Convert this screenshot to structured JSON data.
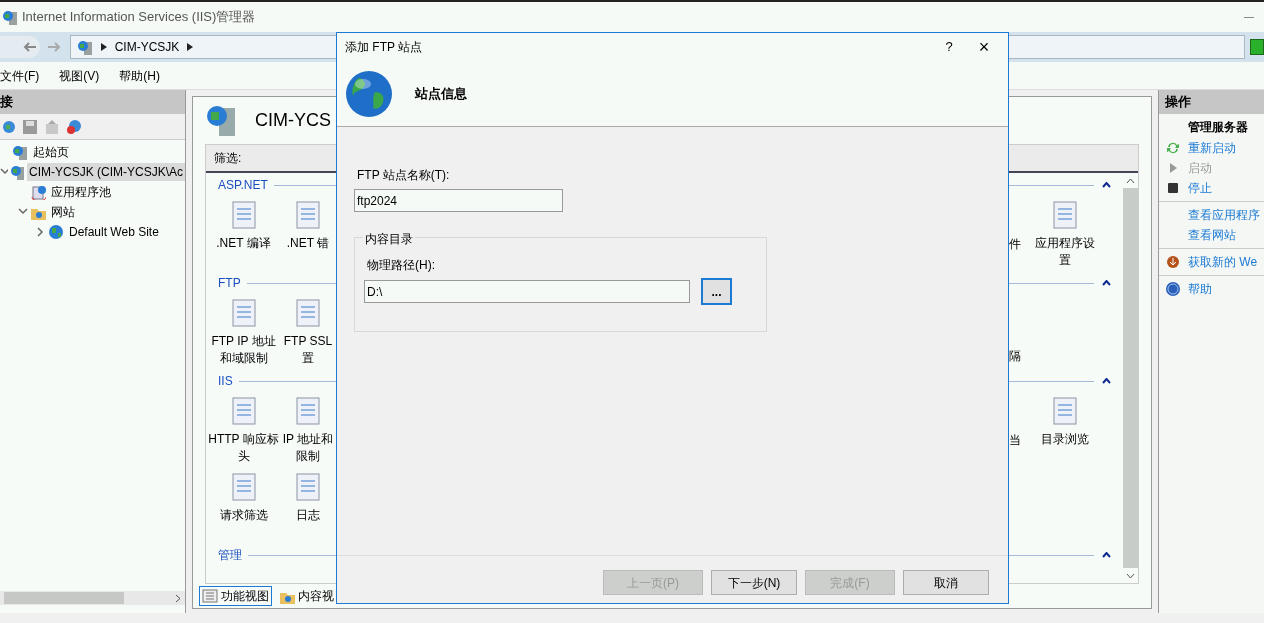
{
  "window": {
    "title": "Internet Information Services (IIS)管理器"
  },
  "address": {
    "segments": [
      "CIM-YCSJK"
    ]
  },
  "menu": [
    "文件(F)",
    "视图(V)",
    "帮助(H)"
  ],
  "connections": {
    "title": "接",
    "tree": [
      {
        "label": "起始页",
        "selected": false
      },
      {
        "label": "CIM-YCSJK (CIM-YCSJK\\Ac",
        "selected": true,
        "expanded": true,
        "children": [
          {
            "label": "应用程序池",
            "selected": false
          },
          {
            "label": "网站",
            "selected": false,
            "expanded": true,
            "children": [
              {
                "label": "Default Web Site",
                "selected": false,
                "expanded": false
              }
            ]
          }
        ]
      }
    ]
  },
  "home": {
    "title": "CIM-YCS",
    "filter_label": "筛选:",
    "sections": [
      {
        "title": "ASP.NET",
        "rows": [
          {
            "left": [
              ".NET 编译",
              ".NET 错"
            ],
            "right": [
              "件",
              "应用程序设置"
            ]
          }
        ]
      },
      {
        "title": "FTP",
        "rows": [
          {
            "left": [
              "FTP IP 地址和域限制",
              "FTP SSL 置"
            ],
            "right": [
              "隔"
            ]
          }
        ]
      },
      {
        "title": "IIS",
        "rows": [
          {
            "left": [
              "HTTP 响应标头",
              "IP 地址和限制"
            ],
            "right": [
              "当",
              "目录浏览"
            ]
          },
          {
            "left": [
              "请求筛选",
              "日志"
            ]
          }
        ]
      },
      {
        "title": "管理"
      }
    ],
    "view_tabs": [
      {
        "label": "功能视图",
        "selected": true
      },
      {
        "label": "内容视",
        "selected": false
      }
    ]
  },
  "actions": {
    "title": "操作",
    "groups": [
      {
        "heading": "管理服务器",
        "items": [
          {
            "label": "重新启动",
            "disabled": false
          },
          {
            "label": "启动",
            "disabled": true
          },
          {
            "label": "停止",
            "disabled": false
          }
        ]
      },
      {
        "items": [
          {
            "label": "查看应用程序",
            "disabled": false
          },
          {
            "label": "查看网站",
            "disabled": false
          }
        ]
      },
      {
        "items": [
          {
            "label": "获取新的 We",
            "disabled": false
          }
        ]
      },
      {
        "items": [
          {
            "label": "帮助",
            "disabled": false
          }
        ]
      }
    ]
  },
  "dialog": {
    "title": "添加 FTP 站点",
    "help": "?",
    "close": "×",
    "heading": "站点信息",
    "site_name": {
      "label": "FTP 站点名称(T):",
      "value": "ftp2024"
    },
    "content_directory": {
      "title": "内容目录",
      "path_label": "物理路径(H):",
      "path_value": "D:\\",
      "browse": "..."
    },
    "buttons": [
      {
        "label": "上一页(P)",
        "disabled": true
      },
      {
        "label": "下一步(N)",
        "disabled": false
      },
      {
        "label": "完成(F)",
        "disabled": true
      },
      {
        "label": "取消",
        "disabled": false
      }
    ]
  }
}
